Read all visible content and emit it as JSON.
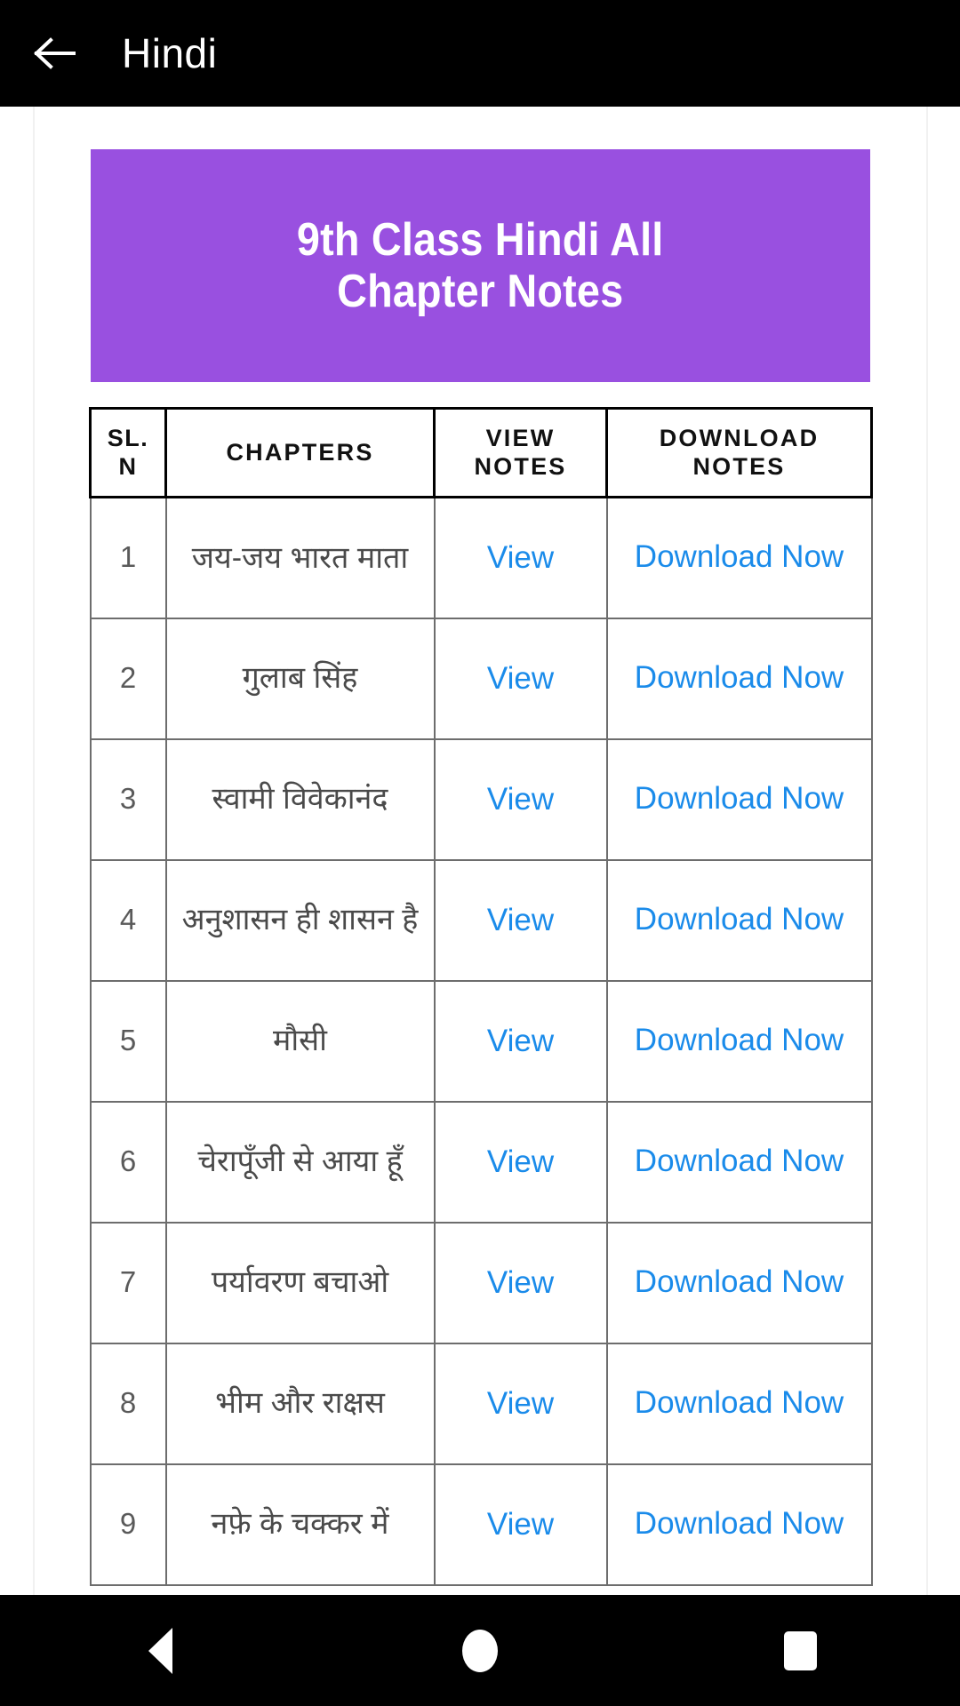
{
  "appbar": {
    "back_icon": "arrow-left-icon",
    "title": "Hindi"
  },
  "banner": {
    "title": "9th Class Hindi All\nChapter Notes",
    "background_color": "#9950e0",
    "text_color": "#ffffff"
  },
  "table": {
    "headers": {
      "sl": "SL.\nN",
      "chapters": "CHAPTERS",
      "view": "VIEW\nNOTES",
      "download": "DOWNLOAD\nNOTES"
    },
    "link_color": "#1a8bea",
    "view_label": "View",
    "download_label": "Download Now",
    "rows": [
      {
        "sl": "1",
        "chapter": "जय-जय भारत माता",
        "view": "View",
        "download": "Download Now"
      },
      {
        "sl": "2",
        "chapter": "गुलाब सिंह",
        "view": "View",
        "download": "Download Now"
      },
      {
        "sl": "3",
        "chapter": "स्वामी विवेकानंद",
        "view": "View",
        "download": "Download Now"
      },
      {
        "sl": "4",
        "chapter": "अनुशासन ही शासन है",
        "view": "View",
        "download": "Download Now"
      },
      {
        "sl": "5",
        "chapter": "मौसी",
        "view": "View",
        "download": "Download Now"
      },
      {
        "sl": "6",
        "chapter": "चेरापूँजी से आया हूँ",
        "view": "View",
        "download": "Download Now"
      },
      {
        "sl": "7",
        "chapter": "पर्यावरण बचाओ",
        "view": "View",
        "download": "Download Now"
      },
      {
        "sl": "8",
        "chapter": "भीम और राक्षस",
        "view": "View",
        "download": "Download Now"
      },
      {
        "sl": "9",
        "chapter": "नफ़े के चक्कर में",
        "view": "View",
        "download": "Download Now"
      }
    ]
  },
  "navbar": {
    "back": "back-triangle-icon",
    "home": "home-circle-icon",
    "recents": "recents-square-icon"
  }
}
